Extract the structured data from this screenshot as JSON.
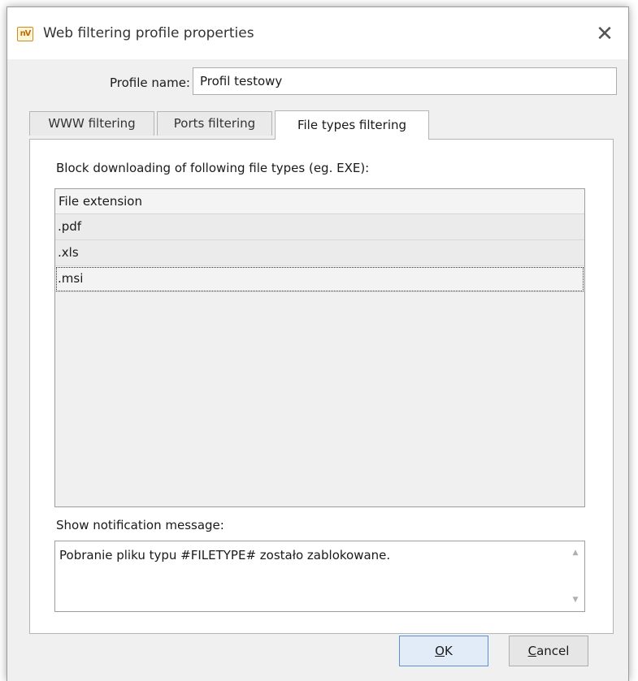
{
  "window": {
    "title": "Web filtering profile properties",
    "app_icon_text": "nV",
    "close_symbol": "✕"
  },
  "profile": {
    "label": "Profile name:",
    "value": "Profil testowy"
  },
  "tabs": [
    {
      "label": "WWW filtering",
      "active": false
    },
    {
      "label": "Ports filtering",
      "active": false
    },
    {
      "label": "File types filtering",
      "active": true
    }
  ],
  "file_types": {
    "block_label": "Block downloading of following file types (eg. EXE):",
    "column_header": "File extension",
    "rows": [
      ".pdf",
      ".xls",
      ".msi"
    ],
    "selected_row": ".msi"
  },
  "notification": {
    "label": "Show notification message:",
    "message": "Pobranie pliku typu #FILETYPE# zostało zablokowane."
  },
  "buttons": {
    "ok_accel": "O",
    "ok_rest": "K",
    "cancel_accel": "C",
    "cancel_rest": "ancel"
  },
  "icons": {
    "close": "close-icon",
    "app": "app-icon",
    "scroll_up": "scroll-up-arrow-icon",
    "scroll_down": "scroll-down-arrow-icon"
  }
}
